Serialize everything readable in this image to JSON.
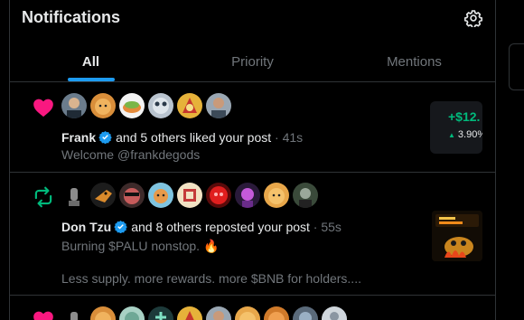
{
  "header": {
    "title": "Notifications",
    "settings_icon": "gear-icon"
  },
  "tabs": [
    {
      "label": "All",
      "active": true
    },
    {
      "label": "Priority",
      "active": false
    },
    {
      "label": "Mentions",
      "active": false
    }
  ],
  "notifications": [
    {
      "kind": "like",
      "kind_icon": "heart-icon",
      "accent": "#f91880",
      "actor": "Frank",
      "verified": true,
      "action_text": "and 5 others liked your post",
      "time": "41s",
      "excerpt": "Welcome @frankdegods",
      "avatar_count": 6,
      "trade_card": {
        "price": "+$12.",
        "change": "3.90%",
        "color": "#00ba7c"
      }
    },
    {
      "kind": "repost",
      "kind_icon": "repost-icon",
      "accent": "#00ba7c",
      "actor": "Don Tzu",
      "verified": true,
      "action_text": "and 8 others reposted your post",
      "time": "55s",
      "excerpt": "Burning $PALU nonstop. 🔥",
      "excerpt_2": "Less supply. more rewards. more $BNB for holders....",
      "avatar_count": 9,
      "thumbnail_icon": "palu-burning-image"
    },
    {
      "kind": "like",
      "kind_icon": "heart-icon",
      "accent": "#f91880",
      "avatar_count": 10
    }
  ]
}
